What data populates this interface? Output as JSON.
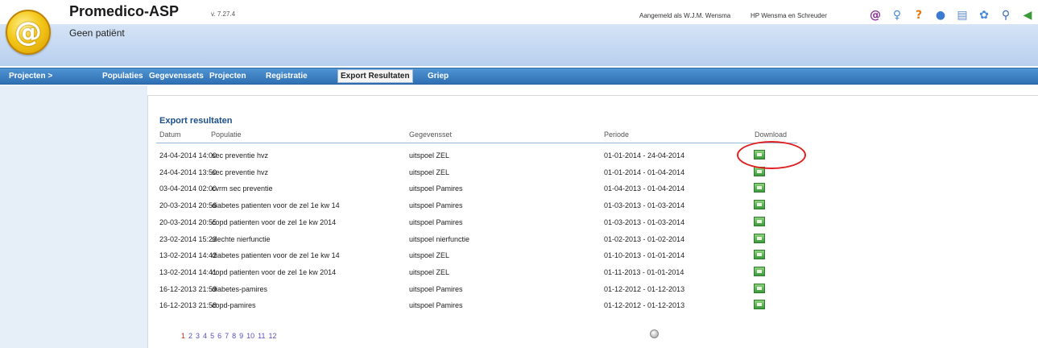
{
  "header": {
    "app_title": "Promedico-ASP",
    "version": "v. 7.27.4",
    "patient": "Geen patiënt",
    "user_info": "Aangemeld als W.J.M. Wensma",
    "practice_info": "HP Wensma en Schreuder",
    "icons": [
      {
        "name": "at-icon",
        "glyph": "@",
        "color": "#8a2a9a"
      },
      {
        "name": "people-icon",
        "glyph": "♀",
        "color": "#4a8ad8"
      },
      {
        "name": "question-icon",
        "glyph": "?",
        "color": "#e07a10"
      },
      {
        "name": "info-icon",
        "glyph": "●",
        "color": "#3a7ad0"
      },
      {
        "name": "document-icon",
        "glyph": "▤",
        "color": "#5a8ac8"
      },
      {
        "name": "settings-icon",
        "glyph": "✿",
        "color": "#4a8ad8"
      },
      {
        "name": "search-icon",
        "glyph": "⚲",
        "color": "#3a6ab8"
      },
      {
        "name": "logout-icon",
        "glyph": "◀",
        "color": "#3a9a3a"
      }
    ]
  },
  "nav": {
    "root": "Projecten >",
    "items": [
      "Populaties",
      "Gegevenssets",
      "Projecten",
      "Registratie",
      "Export Resultaten",
      "Griep"
    ],
    "active": "Export Resultaten"
  },
  "export": {
    "title": "Export resultaten",
    "columns": {
      "datum": "Datum",
      "populatie": "Populatie",
      "gegevensset": "Gegevensset",
      "periode": "Periode",
      "download": "Download"
    },
    "rows": [
      {
        "datum": "24-04-2014 14:00",
        "populatie": "sec preventie hvz",
        "gegevensset": "uitspoel ZEL",
        "periode": "01-01-2014 - 24-04-2014"
      },
      {
        "datum": "24-04-2014 13:50",
        "populatie": "sec preventie hvz",
        "gegevensset": "uitspoel ZEL",
        "periode": "01-01-2014 - 01-04-2014"
      },
      {
        "datum": "03-04-2014 02:00",
        "populatie": "cvrm sec preventie",
        "gegevensset": "uitspoel Pamires",
        "periode": "01-04-2013 - 01-04-2014"
      },
      {
        "datum": "20-03-2014 20:56",
        "populatie": "diabetes patienten voor de zel 1e kw 14",
        "gegevensset": "uitspoel Pamires",
        "periode": "01-03-2013 - 01-03-2014"
      },
      {
        "datum": "20-03-2014 20:55",
        "populatie": "copd patienten voor de zel 1e kw 2014",
        "gegevensset": "uitspoel Pamires",
        "periode": "01-03-2013 - 01-03-2014"
      },
      {
        "datum": "23-02-2014 15:23",
        "populatie": "slechte nierfunctie",
        "gegevensset": "uitspoel nierfunctie",
        "periode": "01-02-2013 - 01-02-2014"
      },
      {
        "datum": "13-02-2014 14:42",
        "populatie": "diabetes patienten voor de zel 1e kw 14",
        "gegevensset": "uitspoel ZEL",
        "periode": "01-10-2013 - 01-01-2014"
      },
      {
        "datum": "13-02-2014 14:41",
        "populatie": "copd patienten voor de zel 1e kw 2014",
        "gegevensset": "uitspoel ZEL",
        "periode": "01-11-2013 - 01-01-2014"
      },
      {
        "datum": "16-12-2013 21:59",
        "populatie": "diabetes-pamires",
        "gegevensset": "uitspoel Pamires",
        "periode": "01-12-2012 - 01-12-2013"
      },
      {
        "datum": "16-12-2013 21:58",
        "populatie": "copd-pamires",
        "gegevensset": "uitspoel Pamires",
        "periode": "01-12-2012 - 01-12-2013"
      }
    ],
    "pagination": {
      "pages": [
        "1",
        "2",
        "3",
        "4",
        "5",
        "6",
        "7",
        "8",
        "9",
        "10",
        "11",
        "12"
      ],
      "current": "1"
    }
  }
}
